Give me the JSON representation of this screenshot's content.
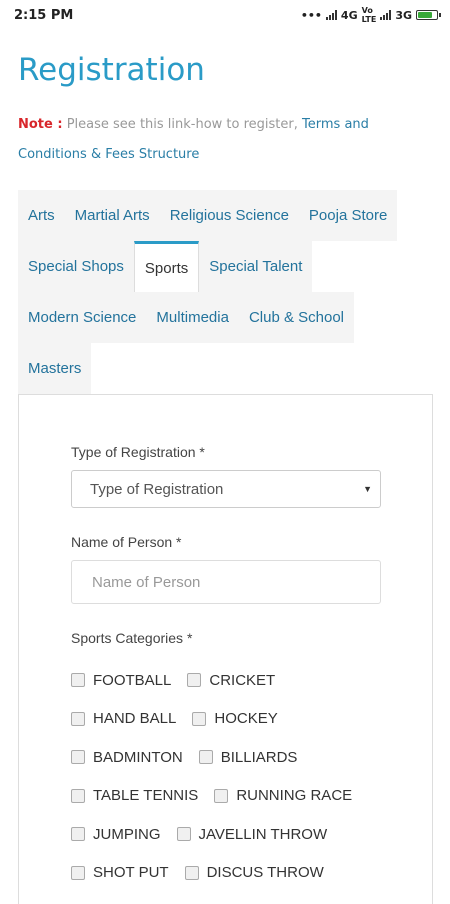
{
  "status": {
    "time": "2:15 PM",
    "net1": "4G",
    "net2": "3G"
  },
  "page": {
    "title": "Registration"
  },
  "note": {
    "label": "Note :",
    "text": "Please see this link-how to register,",
    "link1": "Terms and",
    "link2": "Conditions & Fees Structure"
  },
  "tabs": [
    "Arts",
    "Martial Arts",
    "Religious Science",
    "Pooja Store",
    "Special Shops",
    "Sports",
    "Special Talent",
    "Modern Science",
    "Multimedia",
    "Club & School",
    "Masters"
  ],
  "form": {
    "type_label": "Type of Registration *",
    "type_value": "Type of Registration",
    "name_label": "Name of Person *",
    "name_placeholder": "Name of Person",
    "sports_label": "Sports Categories *",
    "categories": [
      [
        "FOOTBALL",
        "CRICKET"
      ],
      [
        "HAND BALL",
        "HOCKEY"
      ],
      [
        "BADMINTON",
        "BILLIARDS"
      ],
      [
        "TABLE TENNIS",
        "RUNNING RACE"
      ],
      [
        "JUMPING",
        "JAVELLIN THROW"
      ],
      [
        "SHOT PUT",
        "DISCUS THROW"
      ]
    ]
  }
}
